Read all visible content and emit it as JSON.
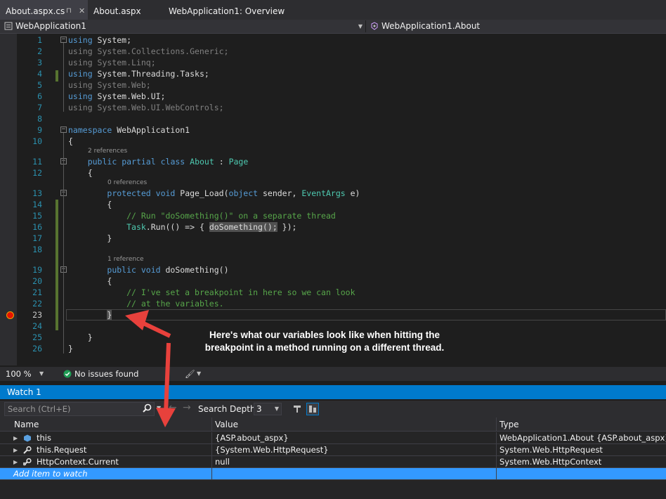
{
  "tabs": [
    {
      "label": "About.aspx.cs",
      "active": true
    },
    {
      "label": "About.aspx",
      "active": false
    },
    {
      "label": "WebApplication1: Overview",
      "active": false
    }
  ],
  "nav": {
    "project": "WebApplication1",
    "scope": "WebApplication1.About"
  },
  "code": {
    "line_numbers": [
      "1",
      "2",
      "3",
      "4",
      "5",
      "6",
      "7",
      "8",
      "9",
      "10",
      "11",
      "12",
      "13",
      "14",
      "15",
      "16",
      "17",
      "18",
      "19",
      "20",
      "21",
      "22",
      "23",
      "24",
      "25",
      "26"
    ],
    "lines": {
      "l1_kw": "using",
      "l1_rest": " System;",
      "l2": "using System.Collections.Generic;",
      "l3": "using System.Linq;",
      "l4_kw": "using",
      "l4_rest": " System.Threading.Tasks;",
      "l5": "using System.Web;",
      "l6_kw": "using",
      "l6_rest": " System.Web.UI;",
      "l7": "using System.Web.UI.WebControls;",
      "l9_kw": "namespace",
      "l9_rest": " WebApplication1",
      "l10": "{",
      "lens11": "2 references",
      "l11_kw1": "public",
      "l11_kw2": "partial",
      "l11_kw3": "class",
      "l11_name": "About",
      "l11_colon": " : ",
      "l11_base": "Page",
      "l12": "{",
      "lens13": "0 references",
      "l13_kw1": "protected",
      "l13_kw2": "void",
      "l13_name": " Page_Load(",
      "l13_kw3": "object",
      "l13_mid": " sender, ",
      "l13_ty": "EventArgs",
      "l13_end": " e)",
      "l14": "{",
      "l15": "// Run \"doSomething()\" on a separate thread",
      "l16_a": "Task",
      "l16_b": ".Run(() => { ",
      "l16_hl": "doSomething();",
      "l16_c": " });",
      "l17": "}",
      "lens19": "1 reference",
      "l19_kw1": "public",
      "l19_kw2": "void",
      "l19_name": " doSomething()",
      "l20": "{",
      "l21": "// I've set a breakpoint in here so we can look",
      "l22": "// at the variables.",
      "l23": "}",
      "l25": "}",
      "l26": "}"
    }
  },
  "annotation": {
    "line1": "Here's what our variables look like when hitting the",
    "line2": "breakpoint in a method running on a different thread."
  },
  "status": {
    "zoom": "100 %",
    "issues": "No issues found"
  },
  "watch": {
    "title": "Watch 1",
    "search_placeholder": "Search (Ctrl+E)",
    "search_depth_label": "Search Depth:",
    "search_depth_value": "3",
    "columns": [
      "Name",
      "Value",
      "Type"
    ],
    "rows": [
      {
        "name": "this",
        "value": "{ASP.about_aspx}",
        "type": "WebApplication1.About {ASP.about_aspx}",
        "icon": "object-icon"
      },
      {
        "name": "this.Request",
        "value": "{System.Web.HttpRequest}",
        "type": "System.Web.HttpRequest",
        "icon": "wrench-icon"
      },
      {
        "name": "HttpContext.Current",
        "value": "null",
        "type": "System.Web.HttpContext",
        "icon": "static-wrench-icon"
      }
    ],
    "add_item": "Add item to watch"
  },
  "colors": {
    "accent": "#007acc",
    "keyword": "#569cd6",
    "type": "#4ec9b0",
    "comment": "#57a64a",
    "selection": "#3399ff",
    "arrow": "#e8413c"
  }
}
